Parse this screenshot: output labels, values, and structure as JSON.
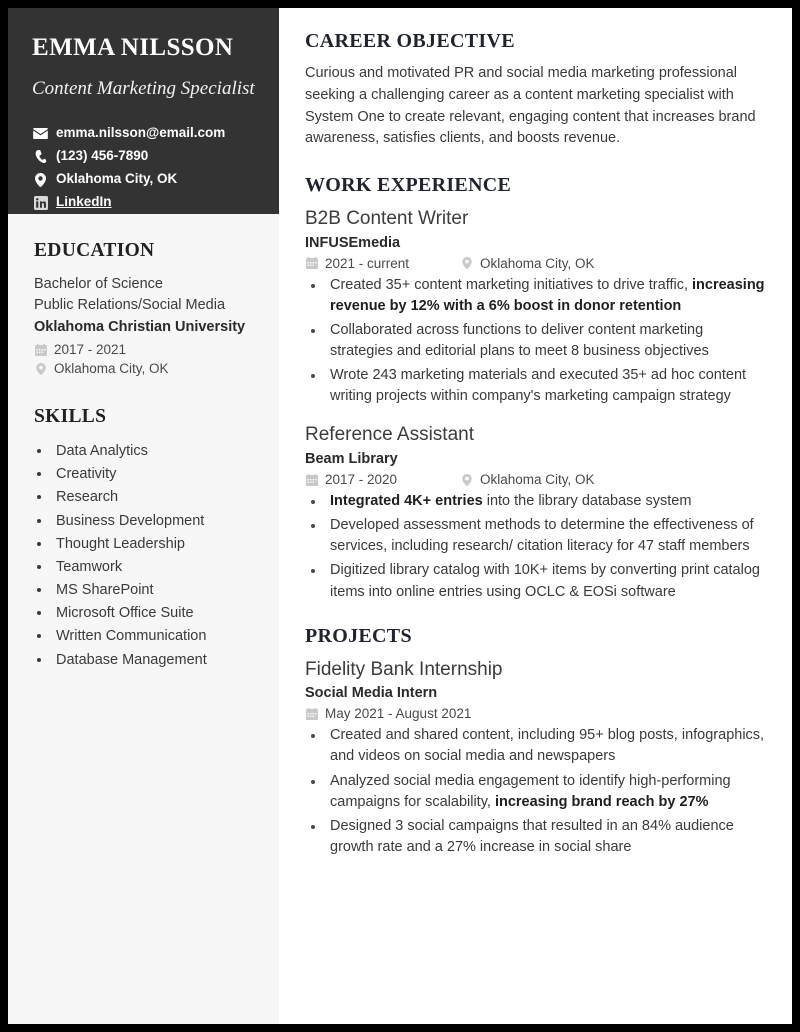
{
  "document": {
    "type": "resume"
  },
  "sidebar": {
    "name": "EMMA NILSSON",
    "job_title": "Content Marketing Specialist",
    "contacts": [
      {
        "icon": "envelope-icon",
        "label": "emma.nilsson@email.com",
        "is_link": false
      },
      {
        "icon": "phone-icon",
        "label": "(123) 456-7890",
        "is_link": false
      },
      {
        "icon": "location-pin-icon",
        "label": "Oklahoma City, OK",
        "is_link": false
      },
      {
        "icon": "linkedin-icon",
        "label": "LinkedIn",
        "is_link": true
      }
    ],
    "education": {
      "heading": "EDUCATION",
      "degree": "Bachelor of Science",
      "field": "Public Relations/Social Media",
      "school": "Oklahoma Christian University",
      "dates": "2017 - 2021",
      "location": "Oklahoma City, OK"
    },
    "skills": {
      "heading": "SKILLS",
      "items": [
        "Data Analytics",
        "Creativity",
        "Research",
        "Business Development",
        "Thought Leadership",
        "Teamwork",
        "MS SharePoint",
        "Microsoft Office Suite",
        "Written Communication",
        "Database Management"
      ]
    }
  },
  "main": {
    "objective": {
      "heading": "CAREER OBJECTIVE",
      "text": "Curious and motivated PR and social media marketing professional seeking a challenging career as a content marketing specialist with System One to create relevant, engaging content that increases brand awareness, satisfies clients, and boosts revenue."
    },
    "work": {
      "heading": "WORK EXPERIENCE",
      "entries": [
        {
          "title": "B2B Content Writer",
          "org": "INFUSEmedia",
          "dates": "2021 - current",
          "location": "Oklahoma City, OK",
          "bullets": [
            "Created 35+ content marketing initiatives to drive traffic, <b>increasing revenue by 12% with a 6% boost in donor retention</b>",
            "Collaborated across functions to deliver content marketing strategies and editorial plans to meet 8 business objectives",
            "Wrote 243 marketing materials and executed 35+ ad hoc content writing projects within company's marketing campaign strategy"
          ]
        },
        {
          "title": "Reference Assistant",
          "org": "Beam Library",
          "dates": "2017 - 2020",
          "location": "Oklahoma City, OK",
          "bullets": [
            "<b>Integrated 4K+ entries</b> into the library database system",
            "Developed assessment methods to determine the effectiveness of services, including research/ citation literacy for 47 staff members",
            "Digitized library catalog with 10K+ items by converting print catalog items into online entries using OCLC &amp; EOSi software"
          ]
        }
      ]
    },
    "projects": {
      "heading": "PROJECTS",
      "entries": [
        {
          "title": "Fidelity Bank Internship",
          "org": "Social Media Intern",
          "dates": "May 2021 - August 2021",
          "location": "",
          "bullets": [
            "Created and shared content, including 95+ blog posts, infographics, and videos on social media and newspapers",
            "Analyzed social media engagement to identify high-performing campaigns for scalability, <b>increasing brand reach by 27%</b>",
            "Designed 3 social campaigns that resulted in an 84% audience growth rate and a 27% increase in social share"
          ]
        }
      ]
    }
  },
  "colors": {
    "header_bg": "#333333",
    "sidebar_bg": "#f7f7f7",
    "page_bg": "#ffffff",
    "border": "#000000",
    "heading_text": "#1f2430",
    "body_text": "#3a3a3a",
    "muted_icon": "#c9c9c9"
  }
}
